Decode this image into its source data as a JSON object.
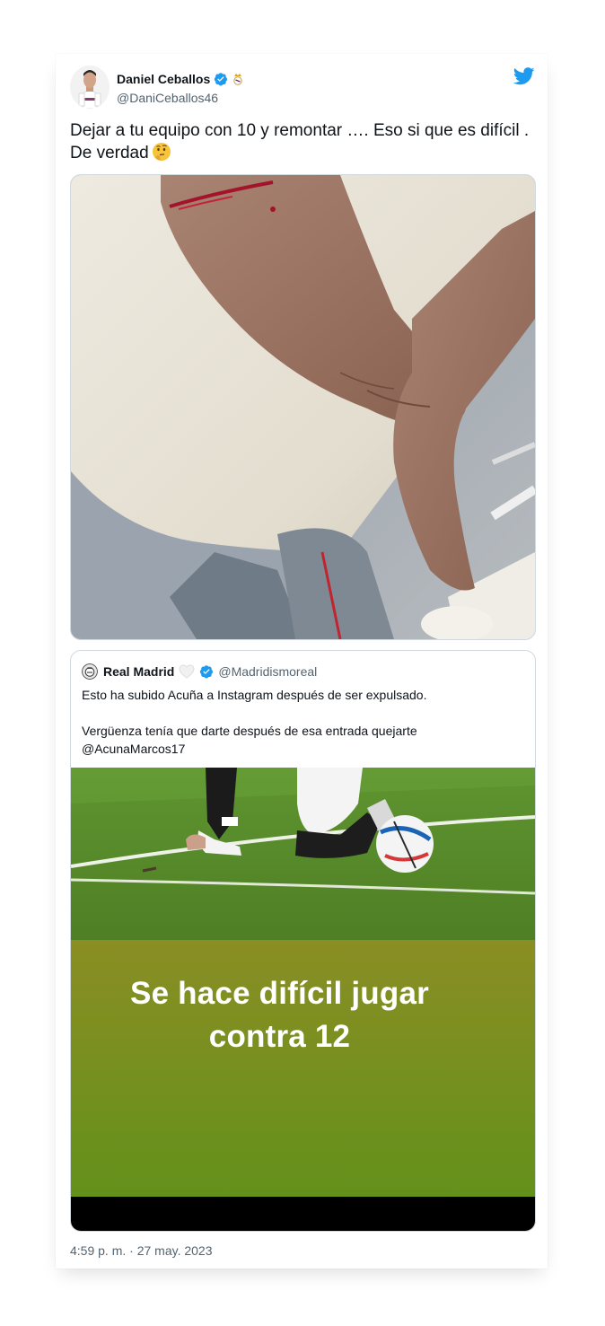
{
  "tweet": {
    "author": {
      "name": "Daniel Ceballos",
      "handle": "@DaniCeballos46",
      "verified": true,
      "avatar_icon": "player-avatar",
      "badge_icon": "real-madrid-crest-icon"
    },
    "text": "Dejar a tu equipo con 10 y remontar …. Eso si que es difícil . De verdad",
    "text_emoji": "thinking-face",
    "media_icon": "injured-foot-photo",
    "timestamp": "4:59 p. m. · 27 may. 2023"
  },
  "quoted_tweet": {
    "author": {
      "name": "Real Madrid",
      "handle": "@Madridismoreal",
      "verified": true,
      "avatar_icon": "club-crest-avatar",
      "extra_icon": "white-heart-icon"
    },
    "text_lines": [
      "Esto ha subido Acuña a Instagram después de ser expulsado.",
      "Vergüenza tenía que darte después de esa entrada quejarte @AcunaMarcos17"
    ],
    "media_icon": "football-player-photo",
    "overlay_text_line1": "Se hace difícil jugar",
    "overlay_text_line2": "contra 12"
  },
  "colors": {
    "twitter_blue": "#1d9bf0",
    "text": "#0f1419",
    "secondary_text": "#536471",
    "border": "#cfd9de",
    "pitch_green": "#6f9a22",
    "overlay_olive": "#86901f"
  }
}
